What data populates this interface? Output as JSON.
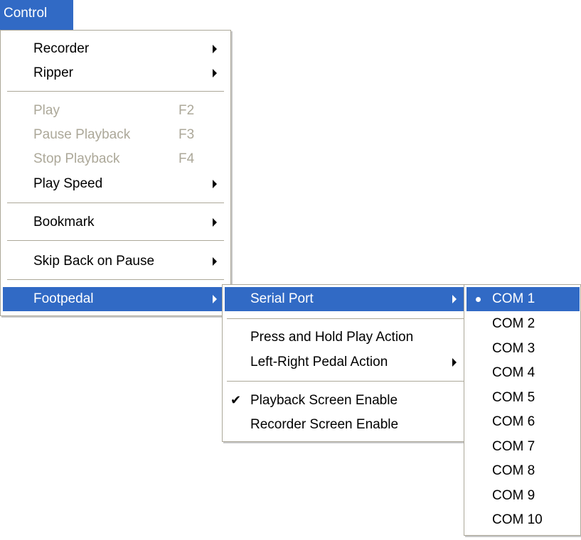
{
  "menubar": {
    "control_label": "Control"
  },
  "control_menu": {
    "items": [
      {
        "label": "Recorder",
        "shortcut": "",
        "submenu": true,
        "disabled": false
      },
      {
        "label": "Ripper",
        "shortcut": "",
        "submenu": true,
        "disabled": false
      },
      {
        "label": "Play",
        "shortcut": "F2",
        "submenu": false,
        "disabled": true
      },
      {
        "label": "Pause Playback",
        "shortcut": "F3",
        "submenu": false,
        "disabled": true
      },
      {
        "label": "Stop Playback",
        "shortcut": "F4",
        "submenu": false,
        "disabled": true
      },
      {
        "label": "Play Speed",
        "shortcut": "",
        "submenu": true,
        "disabled": false
      },
      {
        "label": "Bookmark",
        "shortcut": "",
        "submenu": true,
        "disabled": false
      },
      {
        "label": "Skip Back on Pause",
        "shortcut": "",
        "submenu": true,
        "disabled": false
      },
      {
        "label": "Footpedal",
        "shortcut": "",
        "submenu": true,
        "disabled": false,
        "highlighted": true
      }
    ]
  },
  "footpedal_menu": {
    "items": [
      {
        "label": "Serial Port",
        "submenu": true,
        "highlighted": true
      },
      {
        "label": "Press and Hold Play Action",
        "submenu": false
      },
      {
        "label": "Left-Right Pedal Action",
        "submenu": true
      },
      {
        "label": "Playback Screen Enable",
        "checked": true
      },
      {
        "label": "Recorder Screen Enable",
        "checked": false
      }
    ]
  },
  "serial_port_menu": {
    "selected": "COM 1",
    "items": [
      "COM 1",
      "COM 2",
      "COM 3",
      "COM 4",
      "COM 5",
      "COM 6",
      "COM 7",
      "COM 8",
      "COM 9",
      "COM 10"
    ]
  },
  "colors": {
    "highlight": "#316ac5",
    "disabled_text": "#aca899",
    "border": "#aca899"
  },
  "icons": {
    "submenu": "submenu-arrow-icon",
    "check": "check-icon",
    "radio": "radio-dot-icon"
  }
}
